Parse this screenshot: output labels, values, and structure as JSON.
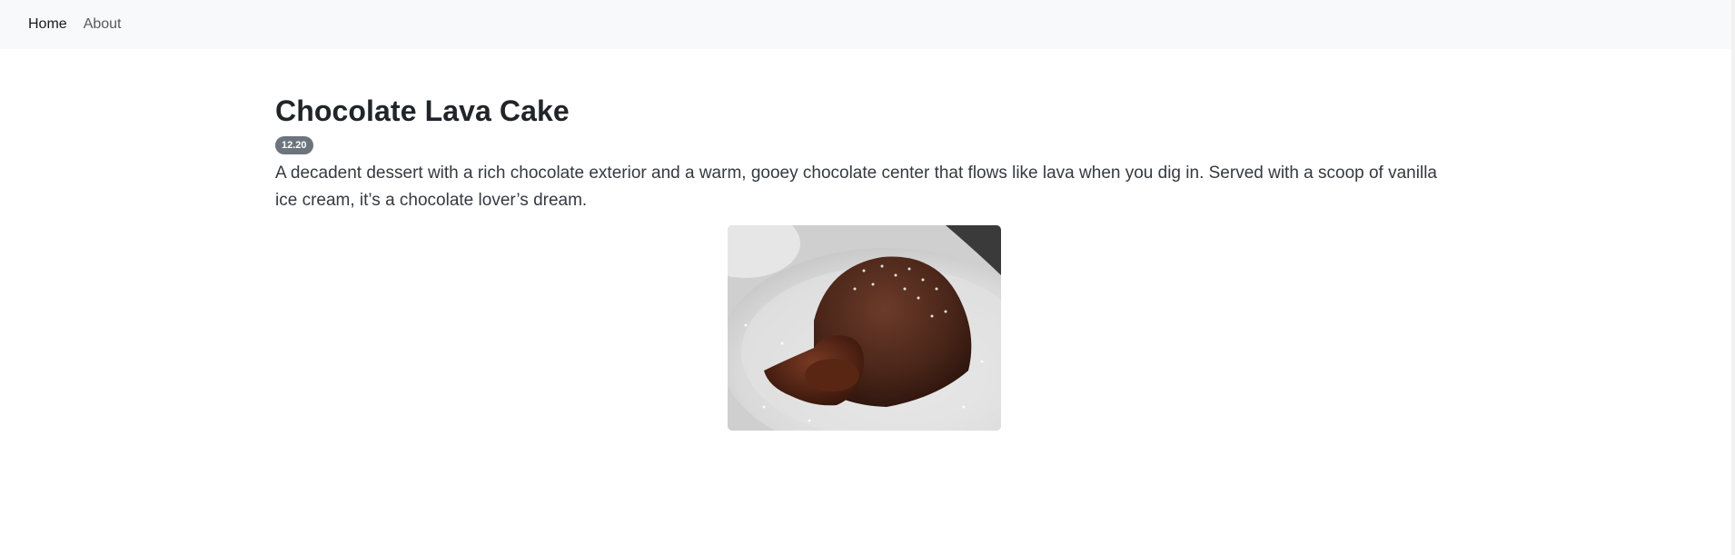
{
  "nav": {
    "items": [
      {
        "label": "Home",
        "active": true
      },
      {
        "label": "About",
        "active": false
      }
    ]
  },
  "recipe": {
    "title": "Chocolate Lava Cake",
    "price": "12.20",
    "description": "A decadent dessert with a rich chocolate exterior and a warm, gooey chocolate center that flows like lava when you dig in. Served with a scoop of vanilla ice cream, it’s a chocolate lover’s dream.",
    "image_icon": "chocolate-lava-cake-photo"
  },
  "colors": {
    "navbar_bg": "#f8f9fa",
    "badge_bg": "#6c757d",
    "text_dark": "#212529"
  }
}
